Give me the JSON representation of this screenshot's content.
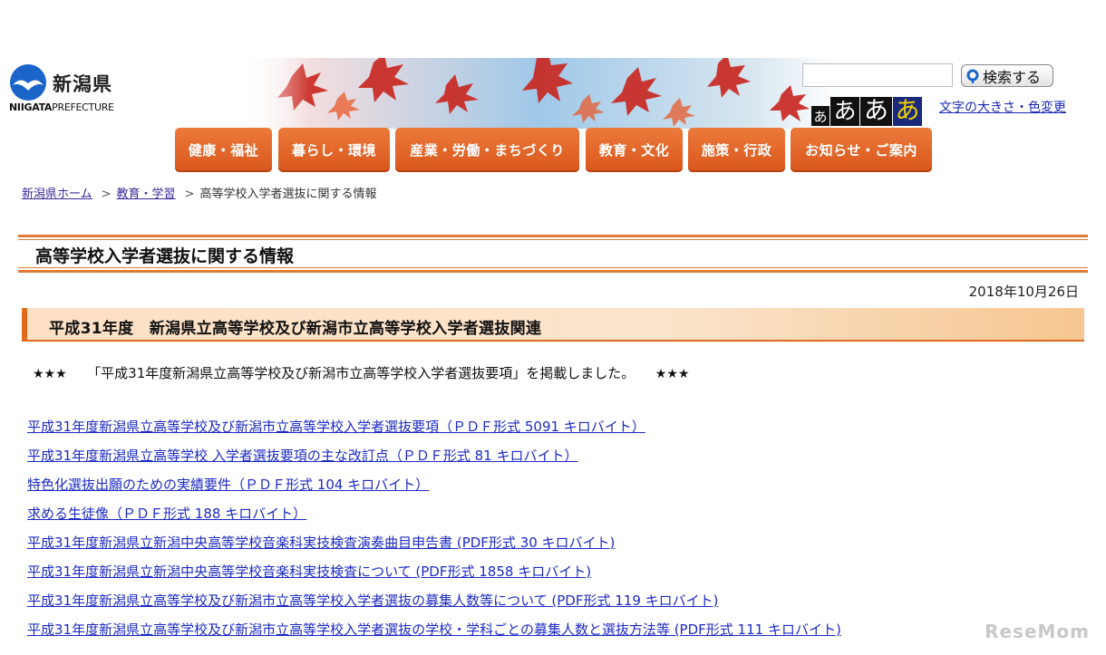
{
  "header": {
    "logo_jp": "新潟県",
    "logo_en_bold": "NIIGATA",
    "logo_en_rest": "PREFECTURE",
    "search": {
      "value": "",
      "button_label": "検索する"
    },
    "font_sizes": [
      "あ",
      "あ",
      "あ",
      "あ"
    ],
    "font_color_link": "文字の大きさ・色変更"
  },
  "global_nav": [
    "健康・福祉",
    "暮らし・環境",
    "産業・労働・まちづくり",
    "教育・文化",
    "施策・行政",
    "お知らせ・ご案内"
  ],
  "breadcrumb": {
    "home": "新潟県ホーム",
    "parent": "教育・学習",
    "sep": ">",
    "current": "高等学校入学者選抜に関する情報"
  },
  "page": {
    "title": "高等学校入学者選抜に関する情報",
    "date": "2018年10月26日",
    "section_heading": "平成31年度　新潟県立高等学校及び新潟市立高等学校入学者選抜関連",
    "notice": {
      "stars": "★★★",
      "text": "「平成31年度新潟県立高等学校及び新潟市立高等学校入学者選抜要項」を掲載しました。"
    },
    "links": [
      "平成31年度新潟県立高等学校及び新潟市立高等学校入学者選抜要項（ＰＤＦ形式  5091 キロバイト）",
      "平成31年度新潟県立高等学校 入学者選抜要項の主な改訂点（ＰＤＦ形式  81 キロバイト）",
      "特色化選抜出願のための実績要件（ＰＤＦ形式  104 キロバイト）",
      "求める生徒像（ＰＤＦ形式  188 キロバイト）",
      "平成31年度新潟県立新潟中央高等学校音楽科実技検査演奏曲目申告書  (PDF形式  30 キロバイト)",
      "平成31年度新潟県立新潟中央高等学校音楽科実技検査について (PDF形式  1858 キロバイト)",
      "平成31年度新潟県立高等学校及び新潟市立高等学校入学者選抜の募集人数等について (PDF形式  119 キロバイト)",
      "平成31年度新潟県立高等学校及び新潟市立高等学校入学者選抜の学校・学科ごとの募集人数と選抜方法等 (PDF形式  111 キロバイト)"
    ]
  },
  "watermark": "ReseMom",
  "colors": {
    "nav_orange": "#e0691a",
    "link_blue": "#1d2bc2",
    "visited_purple": "#3a2b9a"
  }
}
